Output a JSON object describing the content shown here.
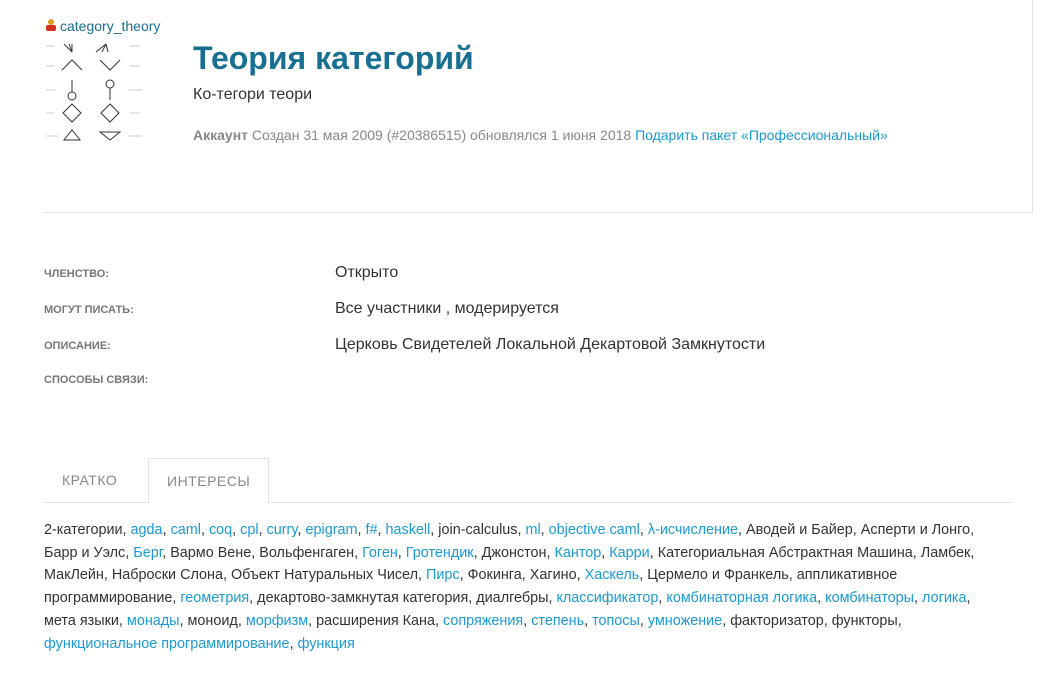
{
  "user": {
    "name": "category_theory"
  },
  "header": {
    "title": "Теория категорий",
    "subtitle": "Ко-тегори теори",
    "meta": {
      "type": "Аккаунт",
      "created": "Создан 31 мая 2009 (#20386515) обновлялся 1 июня 2018",
      "gift_link": "Подарить пакет «Профессиональный»"
    }
  },
  "details": [
    {
      "label": "Членство:",
      "value": "Открыто"
    },
    {
      "label": "Могут писать:",
      "value": "Все участники , модерируется"
    },
    {
      "label": "Описание:",
      "value": "Церковь Свидетелей Локальной Декартовой Замкнутости"
    },
    {
      "label": "Способы связи:",
      "value": ""
    }
  ],
  "tabs": [
    {
      "label": "КРАТКО"
    },
    {
      "label": "ИНТЕРЕСЫ"
    }
  ],
  "interests": [
    {
      "t": "2-категории",
      "link": false
    },
    {
      "t": "agda",
      "link": true
    },
    {
      "t": "caml",
      "link": true
    },
    {
      "t": "coq",
      "link": true
    },
    {
      "t": "cpl",
      "link": true
    },
    {
      "t": "curry",
      "link": true
    },
    {
      "t": "epigram",
      "link": true
    },
    {
      "t": "f#",
      "link": true
    },
    {
      "t": "haskell",
      "link": true
    },
    {
      "t": "join-calculus",
      "link": false
    },
    {
      "t": "ml",
      "link": true
    },
    {
      "t": "objective caml",
      "link": true
    },
    {
      "t": "λ-исчисление",
      "link": true
    },
    {
      "t": "Аводей и Байер",
      "link": false
    },
    {
      "t": "Асперти и Лонго",
      "link": false
    },
    {
      "t": "Барр и Уэлс",
      "link": false
    },
    {
      "t": "Берг",
      "link": true
    },
    {
      "t": "Вармо Вене",
      "link": false
    },
    {
      "t": "Вольфенгаген",
      "link": false
    },
    {
      "t": "Гоген",
      "link": true
    },
    {
      "t": "Гротендик",
      "link": true
    },
    {
      "t": "Джонстон",
      "link": false
    },
    {
      "t": "Кантор",
      "link": true
    },
    {
      "t": "Карри",
      "link": true
    },
    {
      "t": "Категориальная Абстрактная Машина",
      "link": false
    },
    {
      "t": "Ламбек",
      "link": false
    },
    {
      "t": "МакЛейн",
      "link": false
    },
    {
      "t": "Наброски Слона",
      "link": false
    },
    {
      "t": "Объект Натуральных Чисел",
      "link": false
    },
    {
      "t": "Пирс",
      "link": true
    },
    {
      "t": "Фокинга",
      "link": false
    },
    {
      "t": "Хагино",
      "link": false
    },
    {
      "t": "Хаскель",
      "link": true
    },
    {
      "t": "Цермело и Франкель",
      "link": false
    },
    {
      "t": "аппликативное программирование",
      "link": false
    },
    {
      "t": "геометрия",
      "link": true
    },
    {
      "t": "декартово-замкнутая категория",
      "link": false
    },
    {
      "t": "диалгебры",
      "link": false
    },
    {
      "t": "классификатор",
      "link": true
    },
    {
      "t": "комбинаторная логика",
      "link": true
    },
    {
      "t": "комбинаторы",
      "link": true
    },
    {
      "t": "логика",
      "link": true
    },
    {
      "t": "мета языки",
      "link": false
    },
    {
      "t": "монады",
      "link": true
    },
    {
      "t": "моноид",
      "link": false
    },
    {
      "t": "морфизм",
      "link": true
    },
    {
      "t": "расширения Кана",
      "link": false
    },
    {
      "t": "сопряжения",
      "link": true
    },
    {
      "t": "степень",
      "link": true
    },
    {
      "t": "топосы",
      "link": true
    },
    {
      "t": "умножение",
      "link": true
    },
    {
      "t": "факторизатор",
      "link": false
    },
    {
      "t": "функторы",
      "link": false
    },
    {
      "t": "функциональное программирование",
      "link": true
    },
    {
      "t": "функция",
      "link": true
    }
  ]
}
